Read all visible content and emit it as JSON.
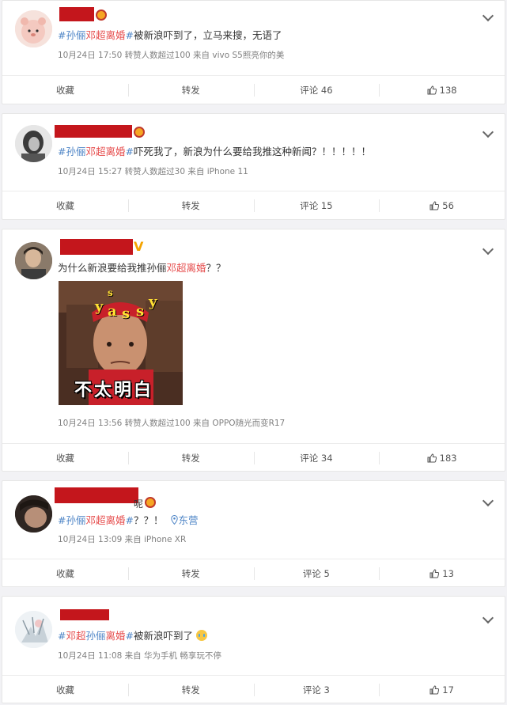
{
  "posts": [
    {
      "topic": "#孙俪邓超离婚#",
      "topic_prefix": "#孙俪",
      "topic_highlight": "邓超离婚",
      "topic_suffix": "#",
      "body": "被新浪吓到了，立马来搜，无语了",
      "meta": "10月24日 17:50  转赞人数超过100  来自 vivo S5照亮你的美",
      "actions": {
        "collect": "收藏",
        "repost": "转发",
        "comment": "评论 46",
        "like": "138"
      }
    },
    {
      "topic_prefix": "#孙俪",
      "topic_highlight": "邓超离婚",
      "topic_suffix": "#",
      "body": "吓死我了，新浪为什么要给我推这种新闻？！！！！！",
      "meta": "10月24日 15:27  转赞人数超过30  来自 iPhone 11",
      "actions": {
        "collect": "收藏",
        "repost": "转发",
        "comment": "评论 15",
        "like": "56"
      }
    },
    {
      "body_prefix": "为什么新浪要给我推孙俪",
      "body_highlight": "邓超离婚",
      "body_suffix": "？？",
      "image_caption": "不太明白",
      "image_text_letters": [
        "y",
        "a",
        "s",
        "s",
        "y",
        "s"
      ],
      "meta": "10月24日 13:56  转赞人数超过100  来自 OPPO随光而变R17",
      "actions": {
        "collect": "收藏",
        "repost": "转发",
        "comment": "评论 34",
        "like": "183"
      }
    },
    {
      "name_tail": "呢",
      "topic_prefix": "#孙俪",
      "topic_highlight": "邓超离婚",
      "topic_suffix": "#",
      "body": "？？！",
      "location": "东营",
      "meta": "10月24日 13:09  来自 iPhone XR",
      "actions": {
        "collect": "收藏",
        "repost": "转发",
        "comment": "评论 5",
        "like": "13"
      }
    },
    {
      "topic_prefix": "#",
      "topic_highlight": "邓超",
      "topic_middle": "孙俪",
      "topic_highlight2": "离婚",
      "topic_suffix": "#",
      "body": "被新浪吓到了",
      "meta": "10月24日 11:08  来自 华为手机 畅享玩不停",
      "actions": {
        "collect": "收藏",
        "repost": "转发",
        "comment": "评论 3",
        "like": "17"
      }
    }
  ],
  "icons": [
    "chevron-down-icon",
    "thumbs-up-icon",
    "location-pin-icon",
    "crown-badge-icon",
    "verified-v-icon",
    "crying-emoji-icon"
  ],
  "colors": {
    "topic": "#4d84c6",
    "highlight": "#e64c4c",
    "redaction": "#c4161c",
    "background": "#f2f2f5"
  }
}
